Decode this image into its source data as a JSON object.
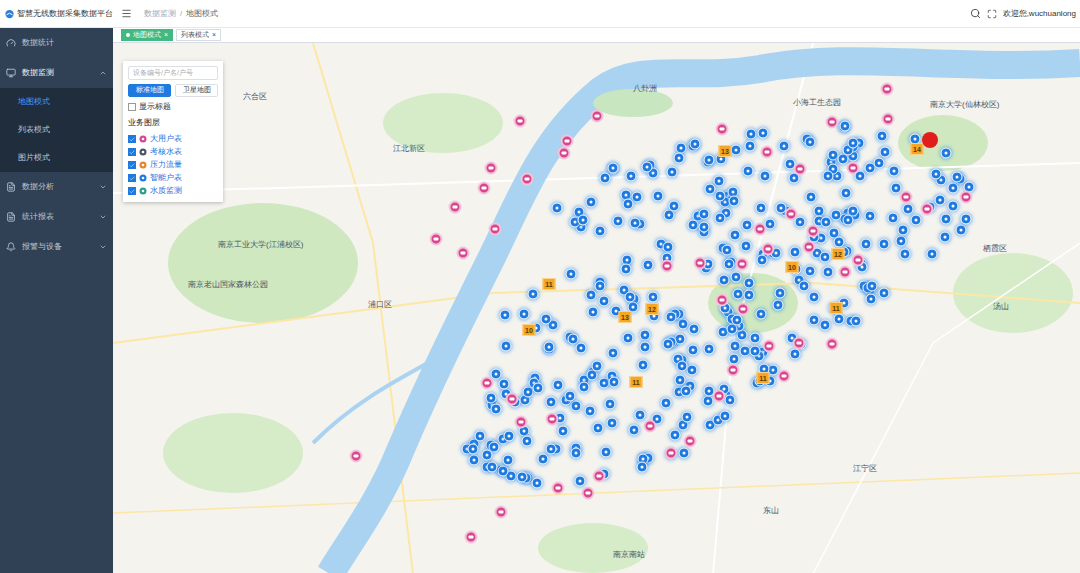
{
  "header": {
    "title": "智慧无线数据采集数据平台",
    "breadcrumb": [
      "数据监测",
      "地图模式"
    ],
    "separator": "/",
    "user": "欢迎您,wuchuanlong"
  },
  "tabs": [
    {
      "label": "地图模式",
      "selected": true,
      "close": "×"
    },
    {
      "label": "列表模式",
      "selected": false,
      "close": "×"
    }
  ],
  "sidebar": {
    "items": [
      {
        "label": "数据统计",
        "has_children": false,
        "expanded": false,
        "children": []
      },
      {
        "label": "数据监测",
        "has_children": true,
        "expanded": true,
        "children": [
          {
            "label": "地图模式",
            "selected": true
          },
          {
            "label": "列表模式",
            "selected": false
          },
          {
            "label": "图片模式",
            "selected": false
          }
        ]
      },
      {
        "label": "数据分析",
        "has_children": true,
        "expanded": false,
        "children": []
      },
      {
        "label": "统计报表",
        "has_children": true,
        "expanded": false,
        "children": []
      },
      {
        "label": "报警与设备",
        "has_children": true,
        "expanded": false,
        "children": []
      }
    ]
  },
  "layer_panel": {
    "search_placeholder": "设备编号/户名/户号",
    "map_types": [
      {
        "label": "标准地图",
        "selected": true
      },
      {
        "label": "卫星地图",
        "selected": false
      }
    ],
    "show_title": {
      "label": "显示标题",
      "checked": false
    },
    "layers_title": "业务图层",
    "layers": [
      {
        "label": "大用户表",
        "checked": true,
        "color": "#d9468f"
      },
      {
        "label": "考核水表",
        "checked": true,
        "color": "#4b5563"
      },
      {
        "label": "压力流量",
        "checked": true,
        "color": "#e6862a"
      },
      {
        "label": "智能户表",
        "checked": true,
        "color": "#1f7ae0"
      },
      {
        "label": "水质监测",
        "checked": true,
        "color": "#2a9d8f"
      }
    ]
  },
  "map": {
    "labels": [
      {
        "text": "南京工业大学(江浦校区)"
      },
      {
        "text": "南京老山国家森林公园"
      },
      {
        "text": "浦口区"
      },
      {
        "text": "江北新区"
      },
      {
        "text": "八卦洲"
      },
      {
        "text": "小海工生态园"
      },
      {
        "text": "南京大学(仙林校区)"
      },
      {
        "text": "栖霞区"
      },
      {
        "text": "汤山"
      },
      {
        "text": "江宁区"
      },
      {
        "text": "东山"
      },
      {
        "text": "南京南站"
      },
      {
        "text": "六合区"
      }
    ],
    "clusters": [
      {
        "label": "13"
      },
      {
        "label": "14"
      },
      {
        "label": "10"
      },
      {
        "label": "12"
      },
      {
        "label": "11"
      },
      {
        "label": "11"
      },
      {
        "label": "10"
      },
      {
        "label": "13"
      },
      {
        "label": "12"
      },
      {
        "label": "11"
      },
      {
        "label": "11"
      }
    ],
    "alarm": {
      "active": true
    }
  }
}
